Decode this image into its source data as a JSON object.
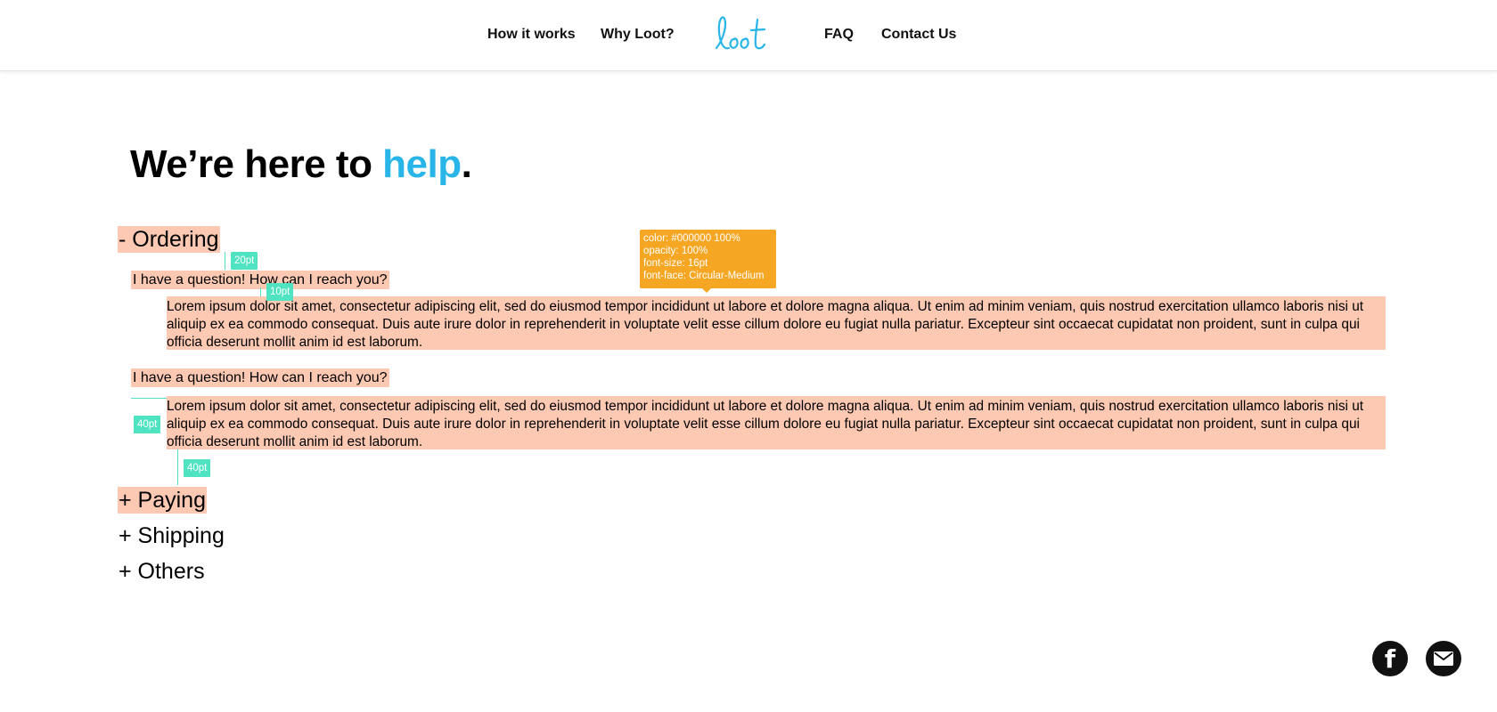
{
  "nav": {
    "links": [
      "How it works",
      "Why Loot?",
      "FAQ",
      "Contact Us"
    ],
    "logo_text": "loot"
  },
  "hero": {
    "title_prefix": "We’re here to ",
    "title_accent": "help",
    "title_suffix": "."
  },
  "faq": {
    "sections": [
      {
        "label": "- Ordering",
        "expanded": true
      },
      {
        "label": "+ Paying",
        "expanded": false
      },
      {
        "label": "+ Shipping",
        "expanded": false
      },
      {
        "label": "+ Others",
        "expanded": false
      }
    ],
    "items": [
      {
        "question": "I have a question! How can I reach you?",
        "answer": "Lorem ipsum dolor sit amet, consectetur adipiscing elit, sed do eiusmod tempor incididunt ut labore et dolore magna aliqua. Ut enim ad minim veniam, quis nostrud exercitation ullamco laboris nisi ut aliquip ex ea commodo consequat. Duis aute irure dolor in reprehenderit in voluptate velit esse cillum dolore eu fugiat nulla pariatur. Excepteur sint occaecat cupidatat non proident, sunt in culpa qui officia deserunt mollit anim id est laborum."
      },
      {
        "question": "I have a question! How can I reach you?",
        "answer": "Lorem ipsum dolor sit amet, consectetur adipiscing elit, sed do eiusmod tempor incididunt ut labore et dolore magna aliqua. Ut enim ad minim veniam, quis nostrud exercitation ullamco laboris nisi ut aliquip ex ea commodo consequat. Duis aute irure dolor in reprehenderit in voluptate velit esse cillum dolore eu fugiat nulla pariatur. Excepteur sint occaecat cupidatat non proident, sunt in culpa qui officia deserunt mollit anim id est laborum."
      }
    ]
  },
  "spec_tooltip": {
    "lines": [
      "color: #000000 100%",
      "opacity: 100%",
      "font-size: 16pt",
      "font-face: Circular-Medium"
    ]
  },
  "measurements": [
    "20pt",
    "10pt",
    "40pt",
    "40pt"
  ],
  "social": {
    "icons": [
      "facebook-icon",
      "mail-icon"
    ],
    "facebook_glyph": "f"
  },
  "colors": {
    "accent": "#29b5e8",
    "highlight": "#fdc9b3",
    "tooltip": "#f5a623",
    "measure": "#50e3c2",
    "text": "#000000"
  }
}
